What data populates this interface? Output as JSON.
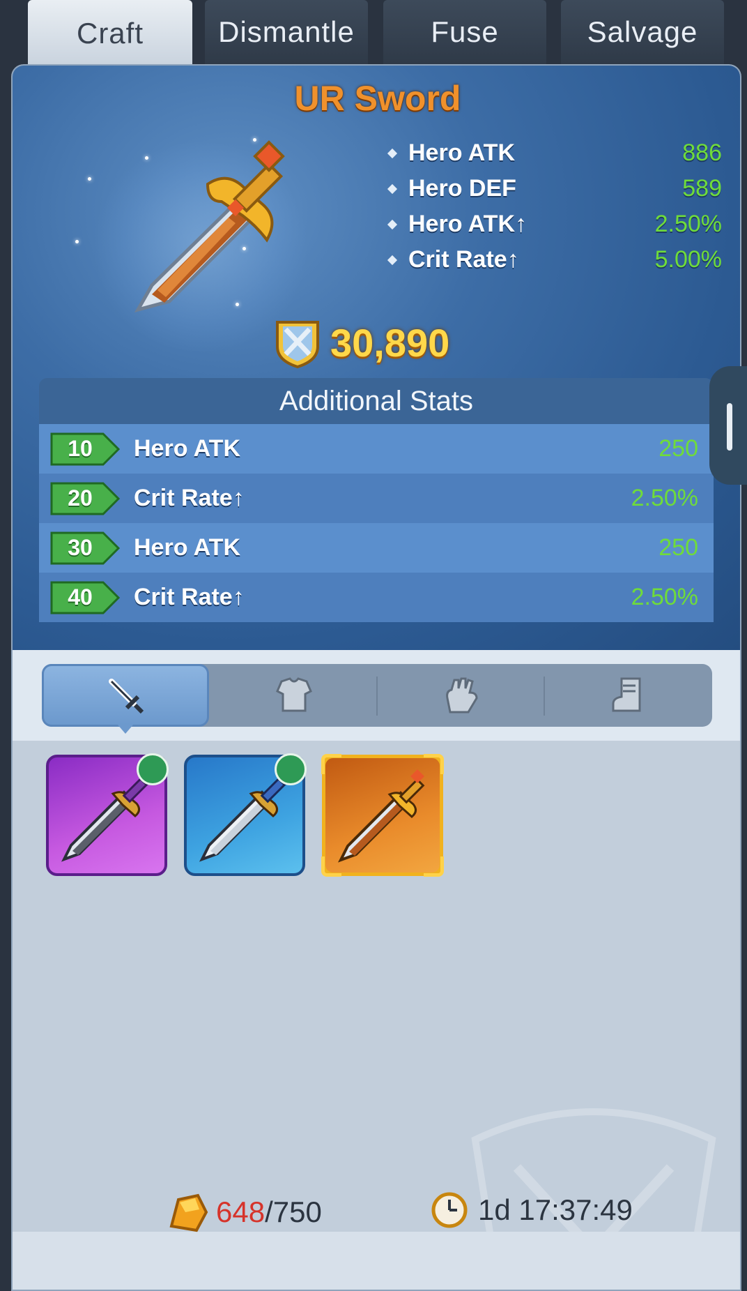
{
  "tabs": [
    {
      "label": "Craft",
      "active": true
    },
    {
      "label": "Dismantle",
      "active": false
    },
    {
      "label": "Fuse",
      "active": false
    },
    {
      "label": "Salvage",
      "active": false
    }
  ],
  "item": {
    "title": "UR Sword",
    "stats": [
      {
        "label": "Hero ATK",
        "value": "886"
      },
      {
        "label": "Hero DEF",
        "value": "589"
      },
      {
        "label": "Hero ATK↑",
        "value": "2.50%"
      },
      {
        "label": "Crit Rate↑",
        "value": "5.00%"
      }
    ],
    "power": "30,890"
  },
  "additional_stats": {
    "header": "Additional Stats",
    "rows": [
      {
        "level": "10",
        "label": "Hero ATK",
        "value": "250"
      },
      {
        "level": "20",
        "label": "Crit Rate↑",
        "value": "2.50%"
      },
      {
        "level": "30",
        "label": "Hero ATK",
        "value": "250"
      },
      {
        "level": "40",
        "label": "Crit Rate↑",
        "value": "2.50%"
      }
    ]
  },
  "filter_tabs": [
    {
      "icon": "sword-icon",
      "active": true
    },
    {
      "icon": "armor-icon",
      "active": false
    },
    {
      "icon": "glove-icon",
      "active": false
    },
    {
      "icon": "boot-icon",
      "active": false
    }
  ],
  "items_grid": [
    {
      "rarity": "purple",
      "icon": "sword-icon",
      "badge": "hammer-icon"
    },
    {
      "rarity": "blue",
      "icon": "sword-icon",
      "badge": "hammer-icon"
    },
    {
      "rarity": "orange",
      "icon": "sword-icon",
      "selected": true
    }
  ],
  "resources": {
    "ore_current": "648",
    "ore_max": "/750",
    "timer": "1d 17:37:49"
  },
  "colors": {
    "stat_value": "#6fdc3a",
    "title": "#f0912c",
    "power": "#ffd84a"
  }
}
